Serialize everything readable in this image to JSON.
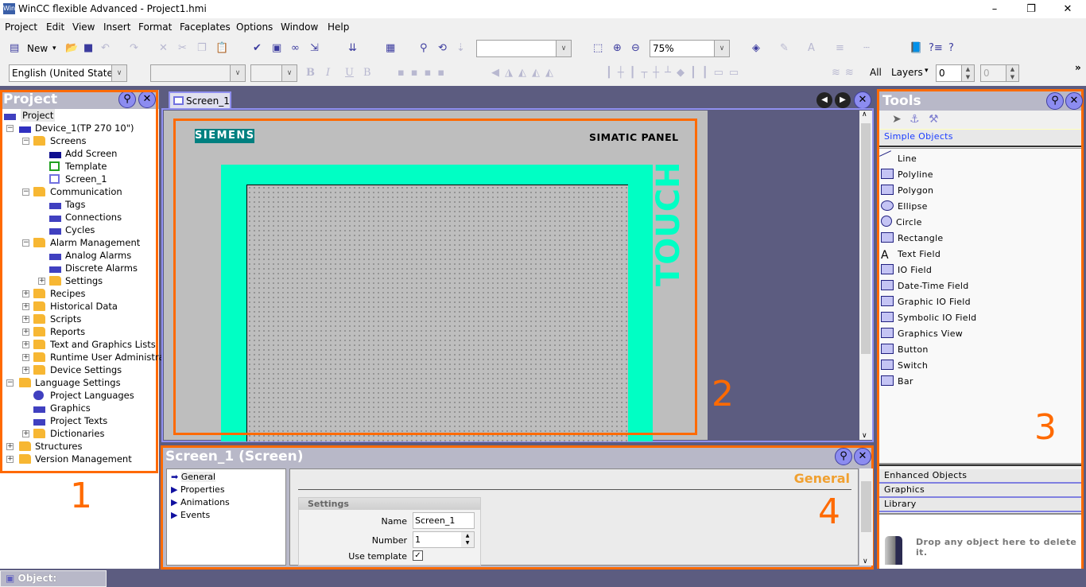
{
  "window": {
    "title": "WinCC flexible Advanced - Project1.hmi",
    "app_icon": "WinCC",
    "minimize": "–",
    "maximize": "❐",
    "close": "✕"
  },
  "menu": [
    "Project",
    "Edit",
    "View",
    "Insert",
    "Format",
    "Faceplates",
    "Options",
    "Window",
    "Help"
  ],
  "toolbar": {
    "new_label": "New",
    "zoom_value": "75%",
    "language_value": "English (United States)",
    "layers_all": "All",
    "layers_label": "Layers",
    "layer_value": "0",
    "layer_value2": "0",
    "overflow": "»"
  },
  "project_panel": {
    "title": "Project",
    "label_number": "1",
    "tree": [
      {
        "label": "Project",
        "level": 0,
        "exp": "",
        "icon": "project-icon"
      },
      {
        "label": "Device_1(TP 270 10\")",
        "level": 1,
        "exp": "−",
        "icon": "device-icon"
      },
      {
        "label": "Screens",
        "level": 2,
        "exp": "−",
        "icon": "folder-icon"
      },
      {
        "label": "Add Screen",
        "level": 3,
        "exp": "",
        "icon": "add-screen-icon"
      },
      {
        "label": "Template",
        "level": 3,
        "exp": "",
        "icon": "template-icon"
      },
      {
        "label": "Screen_1",
        "level": 3,
        "exp": "",
        "icon": "screen-icon"
      },
      {
        "label": "Communication",
        "level": 2,
        "exp": "−",
        "icon": "folder-icon"
      },
      {
        "label": "Tags",
        "level": 3,
        "exp": "",
        "icon": "tags-icon"
      },
      {
        "label": "Connections",
        "level": 3,
        "exp": "",
        "icon": "connections-icon"
      },
      {
        "label": "Cycles",
        "level": 3,
        "exp": "",
        "icon": "cycles-icon"
      },
      {
        "label": "Alarm Management",
        "level": 2,
        "exp": "−",
        "icon": "folder-icon"
      },
      {
        "label": "Analog Alarms",
        "level": 3,
        "exp": "",
        "icon": "analog-alarms-icon"
      },
      {
        "label": "Discrete Alarms",
        "level": 3,
        "exp": "",
        "icon": "discrete-alarms-icon"
      },
      {
        "label": "Settings",
        "level": 3,
        "exp": "+",
        "icon": "folder-icon"
      },
      {
        "label": "Recipes",
        "level": 2,
        "exp": "+",
        "icon": "folder-icon"
      },
      {
        "label": "Historical Data",
        "level": 2,
        "exp": "+",
        "icon": "folder-icon"
      },
      {
        "label": "Scripts",
        "level": 2,
        "exp": "+",
        "icon": "folder-icon"
      },
      {
        "label": "Reports",
        "level": 2,
        "exp": "+",
        "icon": "folder-icon"
      },
      {
        "label": "Text and Graphics Lists",
        "level": 2,
        "exp": "+",
        "icon": "folder-icon"
      },
      {
        "label": "Runtime User Administration",
        "level": 2,
        "exp": "+",
        "icon": "folder-icon"
      },
      {
        "label": "Device Settings",
        "level": 2,
        "exp": "+",
        "icon": "folder-icon"
      },
      {
        "label": "Language Settings",
        "level": 1,
        "exp": "−",
        "icon": "folder-icon"
      },
      {
        "label": "Project Languages",
        "level": 2,
        "exp": "",
        "icon": "globe-icon"
      },
      {
        "label": "Graphics",
        "level": 2,
        "exp": "",
        "icon": "graphics-icon"
      },
      {
        "label": "Project Texts",
        "level": 2,
        "exp": "",
        "icon": "texts-icon"
      },
      {
        "label": "Dictionaries",
        "level": 2,
        "exp": "+",
        "icon": "folder-icon"
      },
      {
        "label": "Structures",
        "level": 1,
        "exp": "+",
        "icon": "folder-icon"
      },
      {
        "label": "Version Management",
        "level": 1,
        "exp": "+",
        "icon": "folder-icon"
      }
    ]
  },
  "editor": {
    "tab": "Screen_1",
    "brand": "SIEMENS",
    "panel_name": "SIMATIC PANEL",
    "touch": "TOUCH",
    "label_number": "2",
    "colors": {
      "frame": "#00ffc4",
      "brand": "#008080",
      "panel": "#bebebe",
      "highlight": "#ff6a00"
    }
  },
  "properties": {
    "title": "Screen_1 (Screen)",
    "nav": [
      "General",
      "Properties",
      "Animations",
      "Events"
    ],
    "section_title": "General",
    "group": "Settings",
    "name_label": "Name",
    "name_value": "Screen_1",
    "number_label": "Number",
    "number_value": "1",
    "template_label": "Use template",
    "use_template": true,
    "label_number": "4"
  },
  "tools": {
    "title": "Tools",
    "active_category": "Simple Objects",
    "items": [
      "Line",
      "Polyline",
      "Polygon",
      "Ellipse",
      "Circle",
      "Rectangle",
      "Text Field",
      "IO Field",
      "Date-Time Field",
      "Graphic IO Field",
      "Symbolic IO Field",
      "Graphics View",
      "Button",
      "Switch",
      "Bar"
    ],
    "categories": [
      "Enhanced Objects",
      "Graphics",
      "Library"
    ],
    "delete_hint": "Drop any object here to delete it.",
    "label_number": "3"
  },
  "statusbar": {
    "object_label": "Object:"
  }
}
